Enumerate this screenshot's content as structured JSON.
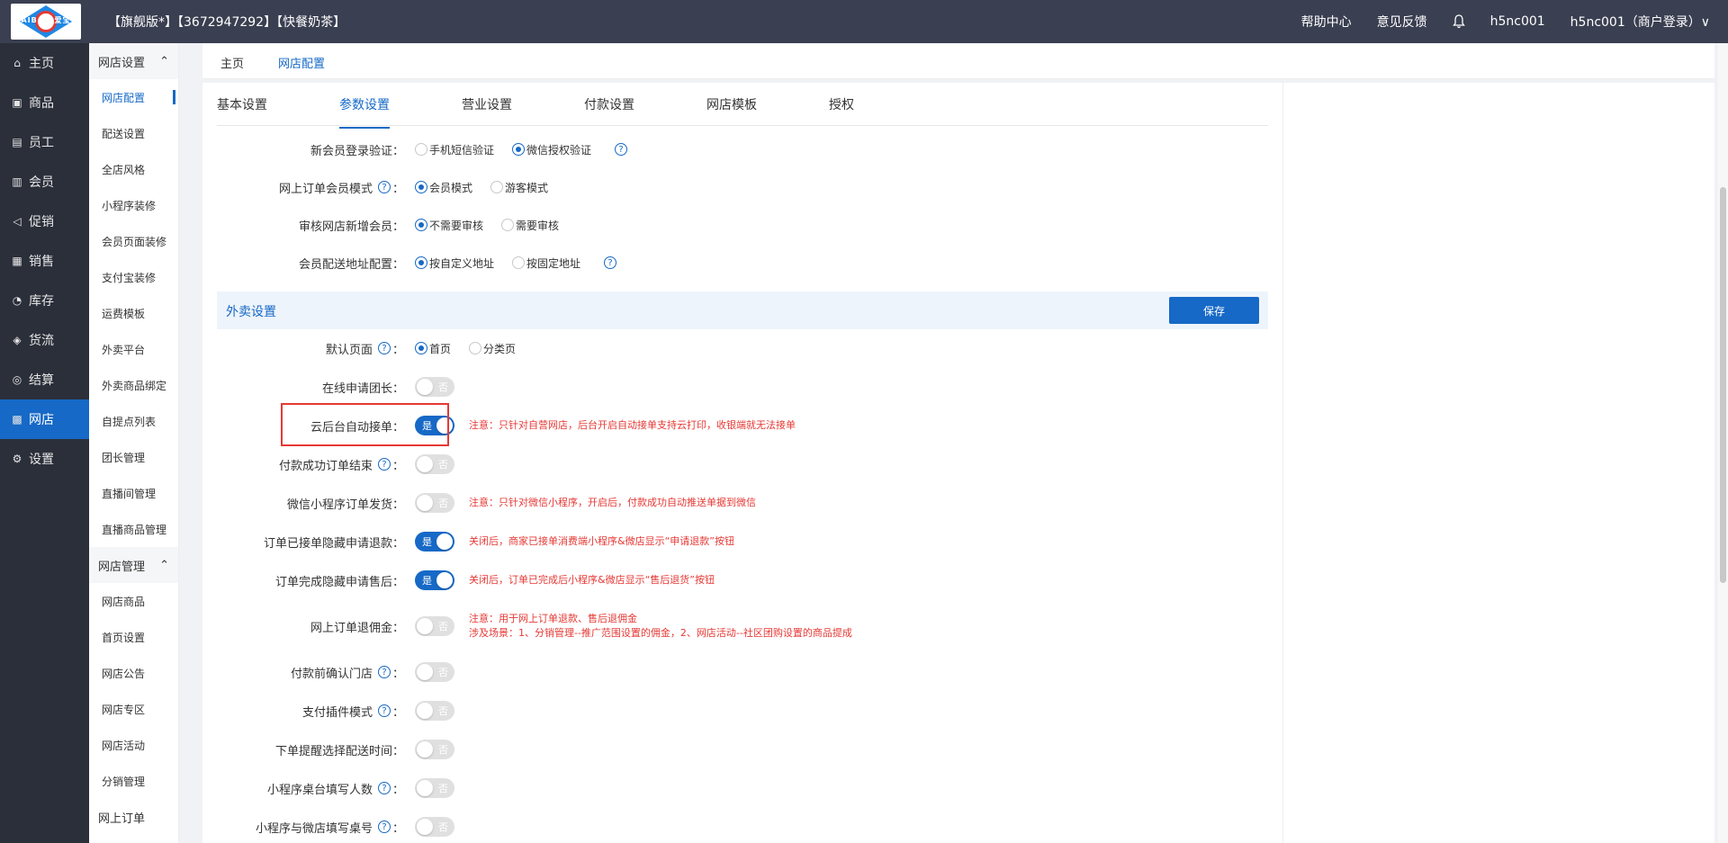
{
  "header": {
    "logo_text": "AIBAO 爱宝",
    "store_title": "【旗舰版*】【3672947292】【快餐奶茶】",
    "links": [
      "帮助中心",
      "意见反馈"
    ],
    "user": "h5nc001",
    "account": "h5nc001（商户登录）∨"
  },
  "sidebar": {
    "items": [
      {
        "label": "主页",
        "icon": "⌂"
      },
      {
        "label": "商品",
        "icon": "▣"
      },
      {
        "label": "员工",
        "icon": "▤"
      },
      {
        "label": "会员",
        "icon": "▥"
      },
      {
        "label": "促销",
        "icon": "◁"
      },
      {
        "label": "销售",
        "icon": "▦"
      },
      {
        "label": "库存",
        "icon": "◔"
      },
      {
        "label": "货流",
        "icon": "◈"
      },
      {
        "label": "结算",
        "icon": "◎"
      },
      {
        "label": "网店",
        "icon": "▩"
      },
      {
        "label": "设置",
        "icon": "⚙"
      }
    ],
    "active_index": 9
  },
  "submenu": {
    "group1": "网店设置",
    "group1_items": [
      "网店配置",
      "配送设置",
      "全店风格",
      "小程序装修",
      "会员页面装修",
      "支付宝装修",
      "运费模板",
      "外卖平台",
      "外卖商品绑定",
      "自提点列表",
      "团长管理",
      "直播间管理",
      "直播商品管理"
    ],
    "group2": "网店管理",
    "group2_items": [
      "网店商品",
      "首页设置",
      "网店公告",
      "网店专区",
      "网店活动",
      "分销管理"
    ],
    "group3": "网上订单"
  },
  "crumbs": [
    "主页",
    "网店配置"
  ],
  "tabs": [
    "基本设置",
    "参数设置",
    "营业设置",
    "付款设置",
    "网店模板",
    "授权"
  ],
  "settings": {
    "new_member": {
      "label": "新会员登录验证：",
      "opt1": "手机短信验证",
      "opt2": "微信授权验证"
    },
    "online_order_mode": {
      "label": "网上订单会员模式",
      "colon": "：",
      "opt1": "会员模式",
      "opt2": "游客模式"
    },
    "review_new_member": {
      "label": "审核网店新增会员：",
      "opt1": "不需要审核",
      "opt2": "需要审核"
    },
    "delivery_address": {
      "label": "会员配送地址配置：",
      "opt1": "按自定义地址",
      "opt2": "按固定地址"
    }
  },
  "section": {
    "title": "外卖设置",
    "save_label": "保存"
  },
  "takeout": {
    "default_page": {
      "label": "默认页面",
      "colon": "：",
      "opt1": "首页",
      "opt2": "分类页"
    },
    "apply_leader": {
      "label": "在线申请团长：",
      "switch": "否"
    },
    "auto_accept": {
      "label": "云后台自动接单：",
      "switch": "是",
      "note": "注意：只针对自营网店，后台开启自动接单支持云打印，收银端就无法接单"
    },
    "pay_success_end": {
      "label": "付款成功订单结束",
      "colon": "：",
      "switch": "否"
    },
    "wechat_ship": {
      "label": "微信小程序订单发货：",
      "switch": "否",
      "note": "注意：只针对微信小程序，开启后，付款成功自动推送单据到微信"
    },
    "hide_refund": {
      "label": "订单已接单隐藏申请退款：",
      "switch": "是",
      "note": "关闭后，商家已接单消费端小程序&微店显示“申请退款”按钮"
    },
    "hide_aftersale": {
      "label": "订单完成隐藏申请售后：",
      "switch": "是",
      "note": "关闭后，订单已完成后小程序&微店显示“售后退货”按钮"
    },
    "refund_commission": {
      "label": "网上订单退佣金：",
      "switch": "否",
      "note1": "注意：用于网上订单退款、售后退佣金",
      "note2": "涉及场景：1、分销管理--推广范围设置的佣金，2、网店活动--社区团购设置的商品提成"
    },
    "confirm_store": {
      "label": "付款前确认门店",
      "colon": "：",
      "switch": "否"
    },
    "pay_plugin": {
      "label": "支付插件模式",
      "colon": "：",
      "switch": "否"
    },
    "reminder_time": {
      "label": "下单提醒选择配送时间：",
      "switch": "否"
    },
    "table_people": {
      "label": "小程序桌台填写人数",
      "colon": "：",
      "switch": "否"
    },
    "table_number": {
      "label": "小程序与微店填写桌号",
      "colon": "：",
      "switch": "否"
    }
  },
  "colors": {
    "accent": "#1669c6",
    "topbar": "#3a3f51",
    "sidebar": "#2b2f3a",
    "warning": "#e53935"
  }
}
